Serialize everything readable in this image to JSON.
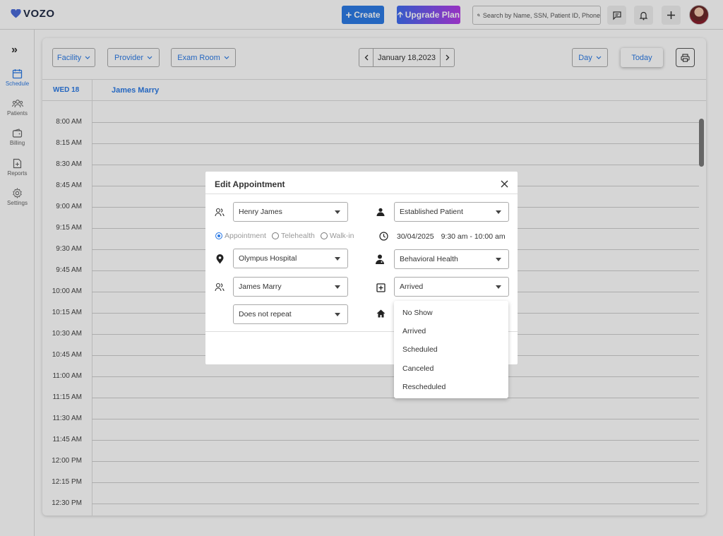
{
  "app": {
    "logo_text": "VOZO",
    "brand_color": "#2d7be5"
  },
  "topbar": {
    "create_label": "Create",
    "upgrade_label": "Upgrade Plan",
    "search_placeholder": "Search by Name, SSN, Patient ID, Phone"
  },
  "sidebar": {
    "items": [
      {
        "label": "Schedule",
        "icon": "calendar-icon",
        "active": true
      },
      {
        "label": "Patients",
        "icon": "users-icon"
      },
      {
        "label": "Billing",
        "icon": "wallet-icon"
      },
      {
        "label": "Reports",
        "icon": "report-icon"
      },
      {
        "label": "Settings",
        "icon": "gear-icon"
      }
    ]
  },
  "toolbar": {
    "filters": [
      "Facility",
      "Provider",
      "Exam Room"
    ],
    "date": "January 18,2023",
    "view": "Day",
    "today_label": "Today"
  },
  "calendar": {
    "day_label": "WED 18",
    "provider": "James Marry",
    "times": [
      "8:00 AM",
      "8:15 AM",
      "8:30 AM",
      "8:45 AM",
      "9:00 AM",
      "9:15 AM",
      "9:30 AM",
      "9:45 AM",
      "10:00 AM",
      "10:15 AM",
      "10:30 AM",
      "10:45 AM",
      "11:00 AM",
      "11:15 AM",
      "11:30 AM",
      "11:45 AM",
      "12:00 PM",
      "12:15 PM",
      "12:30 PM"
    ]
  },
  "modal": {
    "title": "Edit Appointment",
    "patient": "Henry James",
    "patient_type": "Established Patient",
    "appointment_types": [
      "Appointment",
      "Telehealth",
      "Walk-in"
    ],
    "selected_type": "Appointment",
    "date": "30/04/2025",
    "time": "9:30 am - 10:00 am",
    "facility": "Olympus Hospital",
    "specialty": "Behavioral Health",
    "provider": "James Marry",
    "status": "Arrived",
    "repeat": "Does not repeat",
    "status_options": [
      "No Show",
      "Arrived",
      "Scheduled",
      "Canceled",
      "Rescheduled"
    ]
  }
}
